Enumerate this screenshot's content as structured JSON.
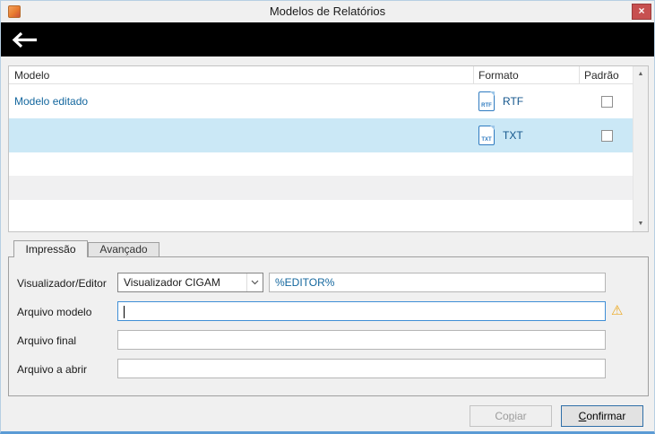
{
  "window": {
    "title": "Modelos de Relatórios"
  },
  "icons": {
    "close": "×",
    "scroll_up": "▲",
    "scroll_down": "▼",
    "warning": "⚠"
  },
  "table": {
    "columns": {
      "modelo": "Modelo",
      "formato": "Formato",
      "padrao": "Padrão"
    },
    "rows": [
      {
        "modelo": "Modelo editado",
        "formato": "RTF",
        "padrao_checked": false,
        "selected": false
      },
      {
        "modelo": "",
        "formato": "TXT",
        "padrao_checked": false,
        "selected": true
      }
    ]
  },
  "tabs": {
    "impressao": "Impressão",
    "avancado": "Avançado"
  },
  "form": {
    "visualizador": {
      "label": "Visualizador/Editor",
      "value": "Visualizador CIGAM",
      "editor_value": "%EDITOR%"
    },
    "arquivo_modelo": {
      "label": "Arquivo modelo",
      "value": ""
    },
    "arquivo_final": {
      "label": "Arquivo final",
      "value": ""
    },
    "arquivo_abrir": {
      "label": "Arquivo a abrir",
      "value": ""
    }
  },
  "buttons": {
    "copiar": {
      "pre": "Co",
      "key": "p",
      "post": "iar"
    },
    "confirmar": {
      "pre": "",
      "key": "C",
      "post": "onfirmar"
    }
  },
  "colors": {
    "accent_blue": "#14679e",
    "selection_blue": "#cbe8f6",
    "focus_border": "#3f8fd6",
    "close_red": "#c75050",
    "warning_yellow": "#eca71c",
    "bottom_accent": "#5b9bd5"
  }
}
